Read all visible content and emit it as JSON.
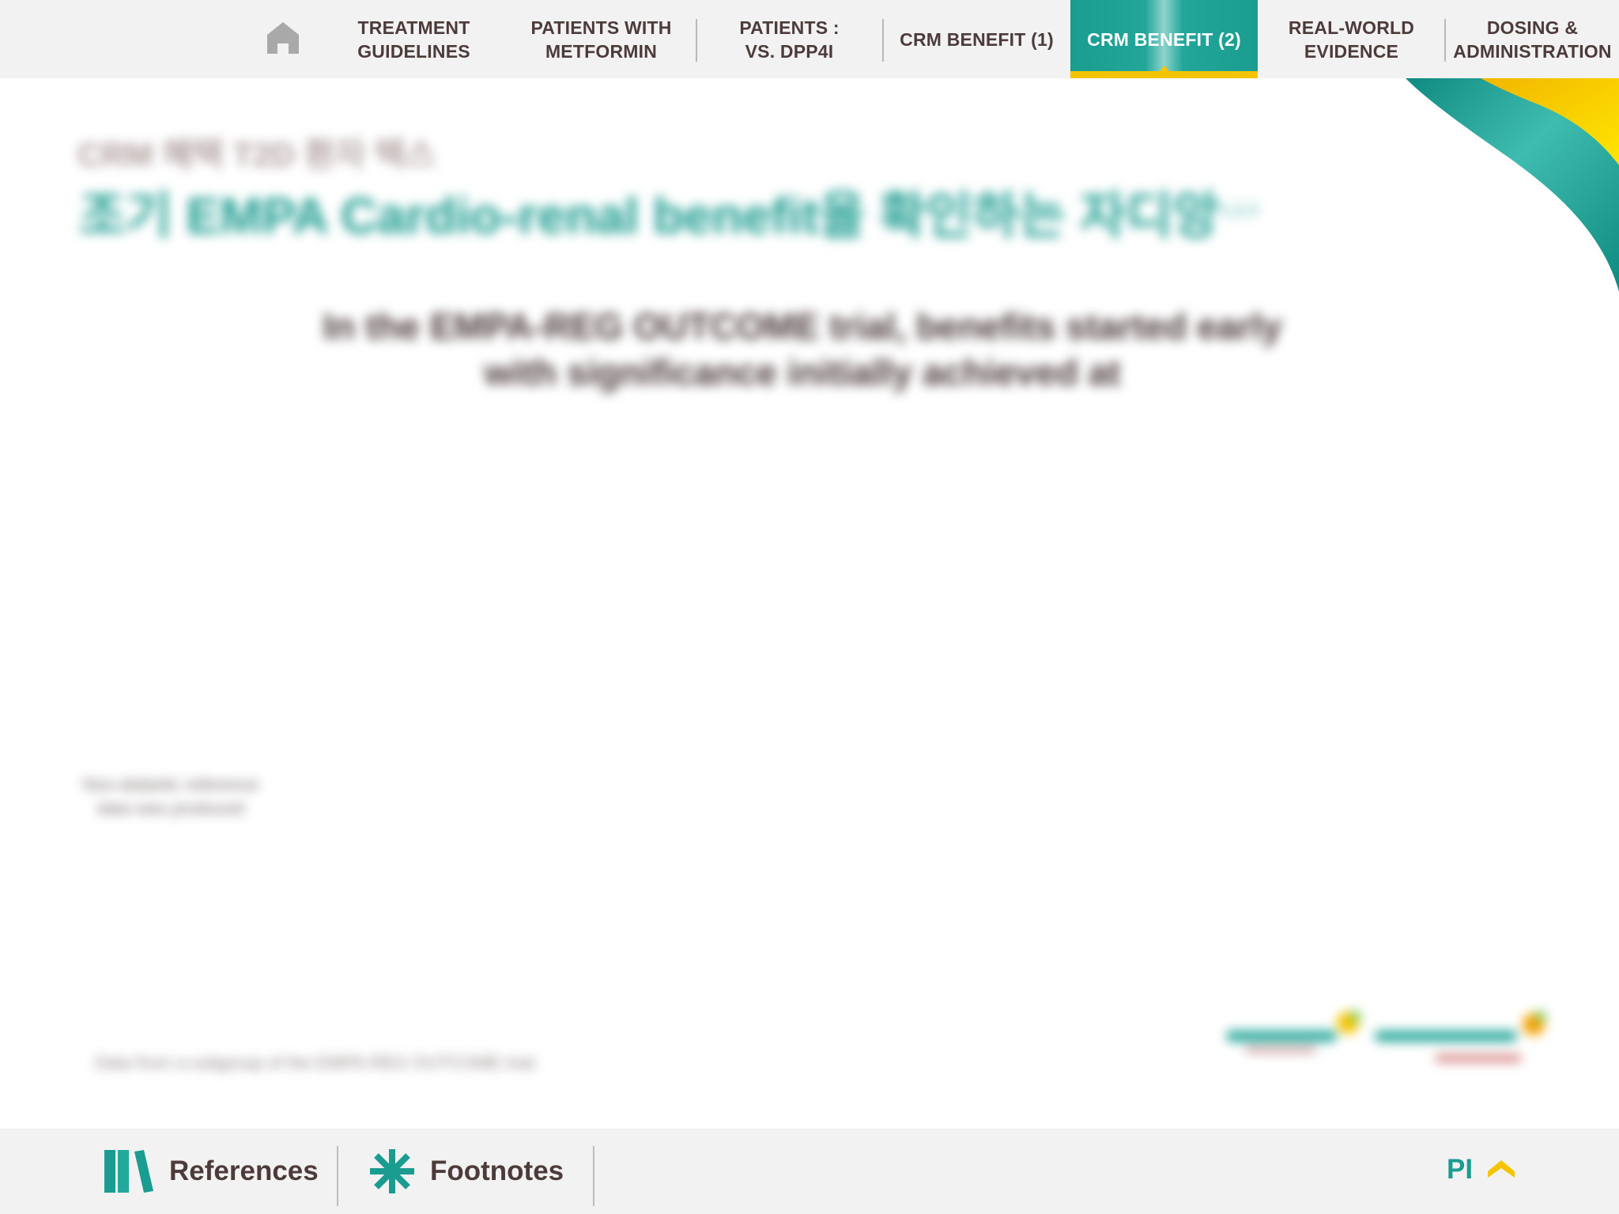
{
  "nav": {
    "home_icon": "home-icon",
    "items": [
      {
        "lines": [
          "TREATMENT",
          "GUIDELINES"
        ]
      },
      {
        "lines": [
          "PATIENTS WITH",
          "METFORMIN"
        ]
      },
      {
        "lines": [
          "PATIENTS :",
          "VS. DPP4I"
        ]
      },
      {
        "lines": [
          "CRM BENEFIT (1)"
        ]
      },
      {
        "lines": [
          "CRM BENEFIT (2)"
        ],
        "active": true
      },
      {
        "lines": [
          "REAL-WORLD",
          "EVIDENCE"
        ]
      },
      {
        "lines": [
          "DOSING &",
          "ADMINISTRATION"
        ]
      }
    ],
    "active_color": "#1a9c91",
    "active_underline": "#f5c400"
  },
  "content": {
    "section_label": "CRM 혜택 T2D 환자 텍스",
    "heading": "조기 EMPA Cardio-renal benefit을 확인하는 자디앙",
    "heading_sup": "1,2,3",
    "lead": "In the EMPA-REG OUTCOME trial, benefits started early with significance initially achieved at",
    "side_note": "Non-diabetic reference data was produced",
    "bottom_note": "Data from a subgroup of the EMPA-REG OUTCOME trial."
  },
  "logos": {
    "left": "JARDIANCE",
    "right": "JARDIANCE DUO"
  },
  "footer": {
    "references_label": "References",
    "references_icon": "books-icon",
    "footnotes_label": "Footnotes",
    "footnotes_icon": "asterisk-icon",
    "pi_label": "PI",
    "up_icon": "chevron-up-icon"
  },
  "colors": {
    "teal": "#1a9c91",
    "yellow": "#f5c400",
    "nav_bg": "#f2f2f2",
    "text_dark": "#4d3b3b"
  }
}
